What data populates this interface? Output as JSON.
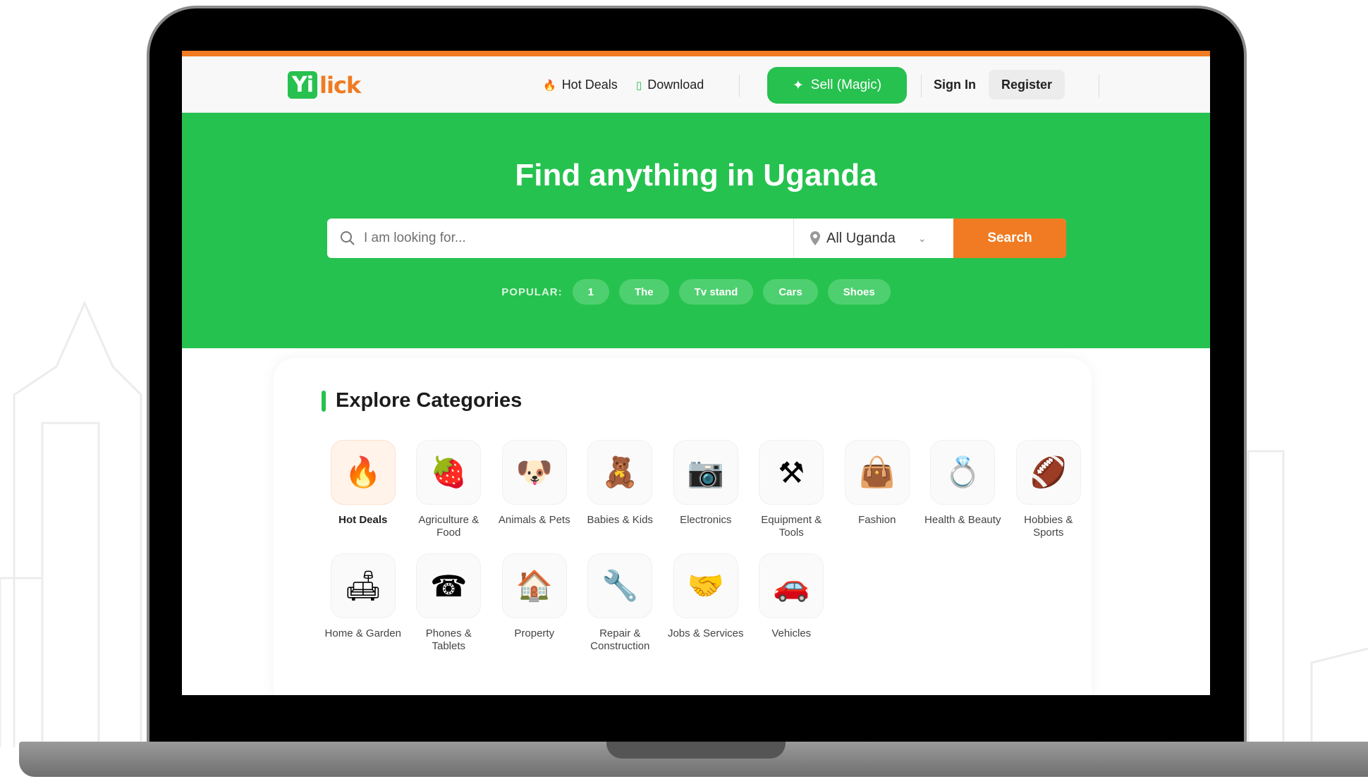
{
  "nav": {
    "logo_yi": "Yi",
    "logo_lick": "lick",
    "hot_deals": "Hot Deals",
    "download": "Download",
    "sell": "Sell (Magic)",
    "sign_in": "Sign In",
    "register": "Register"
  },
  "hero": {
    "title": "Find anything in Uganda",
    "search_placeholder": "I am looking for...",
    "location": "All Uganda",
    "search_button": "Search",
    "popular_label": "POPULAR:",
    "popular_tags": [
      "1",
      "The",
      "Tv stand",
      "Cars",
      "Shoes"
    ]
  },
  "categories": {
    "title": "Explore Categories",
    "items": [
      {
        "label": "Hot Deals",
        "icon": "flame-icon",
        "glyph": "🔥"
      },
      {
        "label": "Agriculture & Food",
        "icon": "strawberry-icon",
        "glyph": "🍓"
      },
      {
        "label": "Animals & Pets",
        "icon": "dog-icon",
        "glyph": "🐶"
      },
      {
        "label": "Babies & Kids",
        "icon": "teddy-bear-icon",
        "glyph": "🧸"
      },
      {
        "label": "Electronics",
        "icon": "camera-icon",
        "glyph": "📷"
      },
      {
        "label": "Equipment & Tools",
        "icon": "anvil-icon",
        "glyph": "⚒"
      },
      {
        "label": "Fashion",
        "icon": "handbag-icon",
        "glyph": "👜"
      },
      {
        "label": "Health & Beauty",
        "icon": "compact-mirror-icon",
        "glyph": "💍"
      },
      {
        "label": "Hobbies & Sports",
        "icon": "football-icon",
        "glyph": "🏈"
      },
      {
        "label": "Home & Garden",
        "icon": "armchair-icon",
        "glyph": "🛋"
      },
      {
        "label": "Phones & Tablets",
        "icon": "telephone-icon",
        "glyph": "☎"
      },
      {
        "label": "Property",
        "icon": "house-icon",
        "glyph": "🏠"
      },
      {
        "label": "Repair & Construction",
        "icon": "drill-icon",
        "glyph": "🔧"
      },
      {
        "label": "Jobs & Services",
        "icon": "handshake-icon",
        "glyph": "🤝"
      },
      {
        "label": "Vehicles",
        "icon": "car-icon",
        "glyph": "🚗"
      }
    ]
  },
  "colors": {
    "brand_green": "#26c24f",
    "accent_orange": "#f07b22"
  }
}
